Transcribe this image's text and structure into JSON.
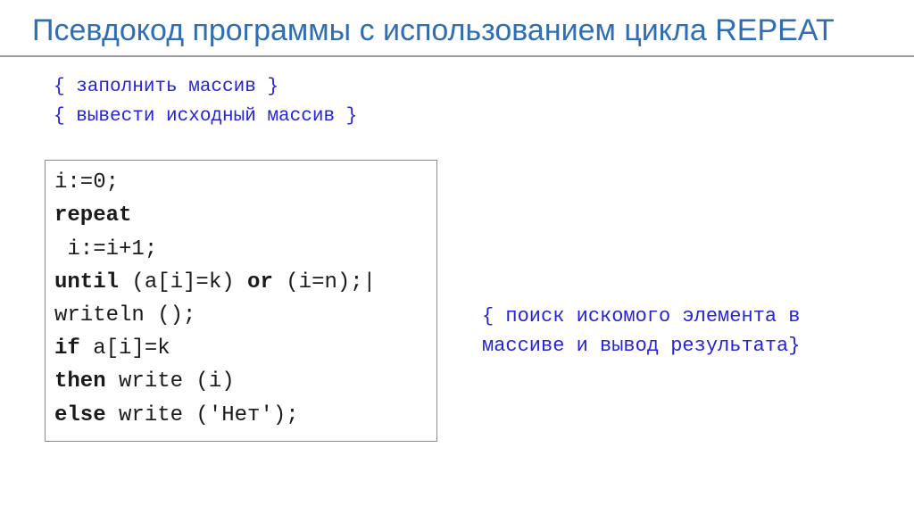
{
  "title": "Псевдокод программы с использованием цикла REPEAT",
  "comment1": "{ заполнить массив }",
  "comment2": "{ вывести исходный массив }",
  "code": {
    "l1": "i:=0;",
    "kw_repeat": "repeat",
    "l3": " i:=i+1;",
    "kw_until": "until",
    "l4_rest": " (a[i]=k) ",
    "kw_or": "or",
    "l4_end": " (i=n);|",
    "l5": "writeln ();",
    "kw_if": "if",
    "l6_rest": " a[i]=k",
    "kw_then": "then",
    "l7_rest": " write (i)",
    "kw_else": "else",
    "l8_rest": " write ('Нет');"
  },
  "side_comment": "{ поиск искомого элемента в массиве и вывод результата}"
}
